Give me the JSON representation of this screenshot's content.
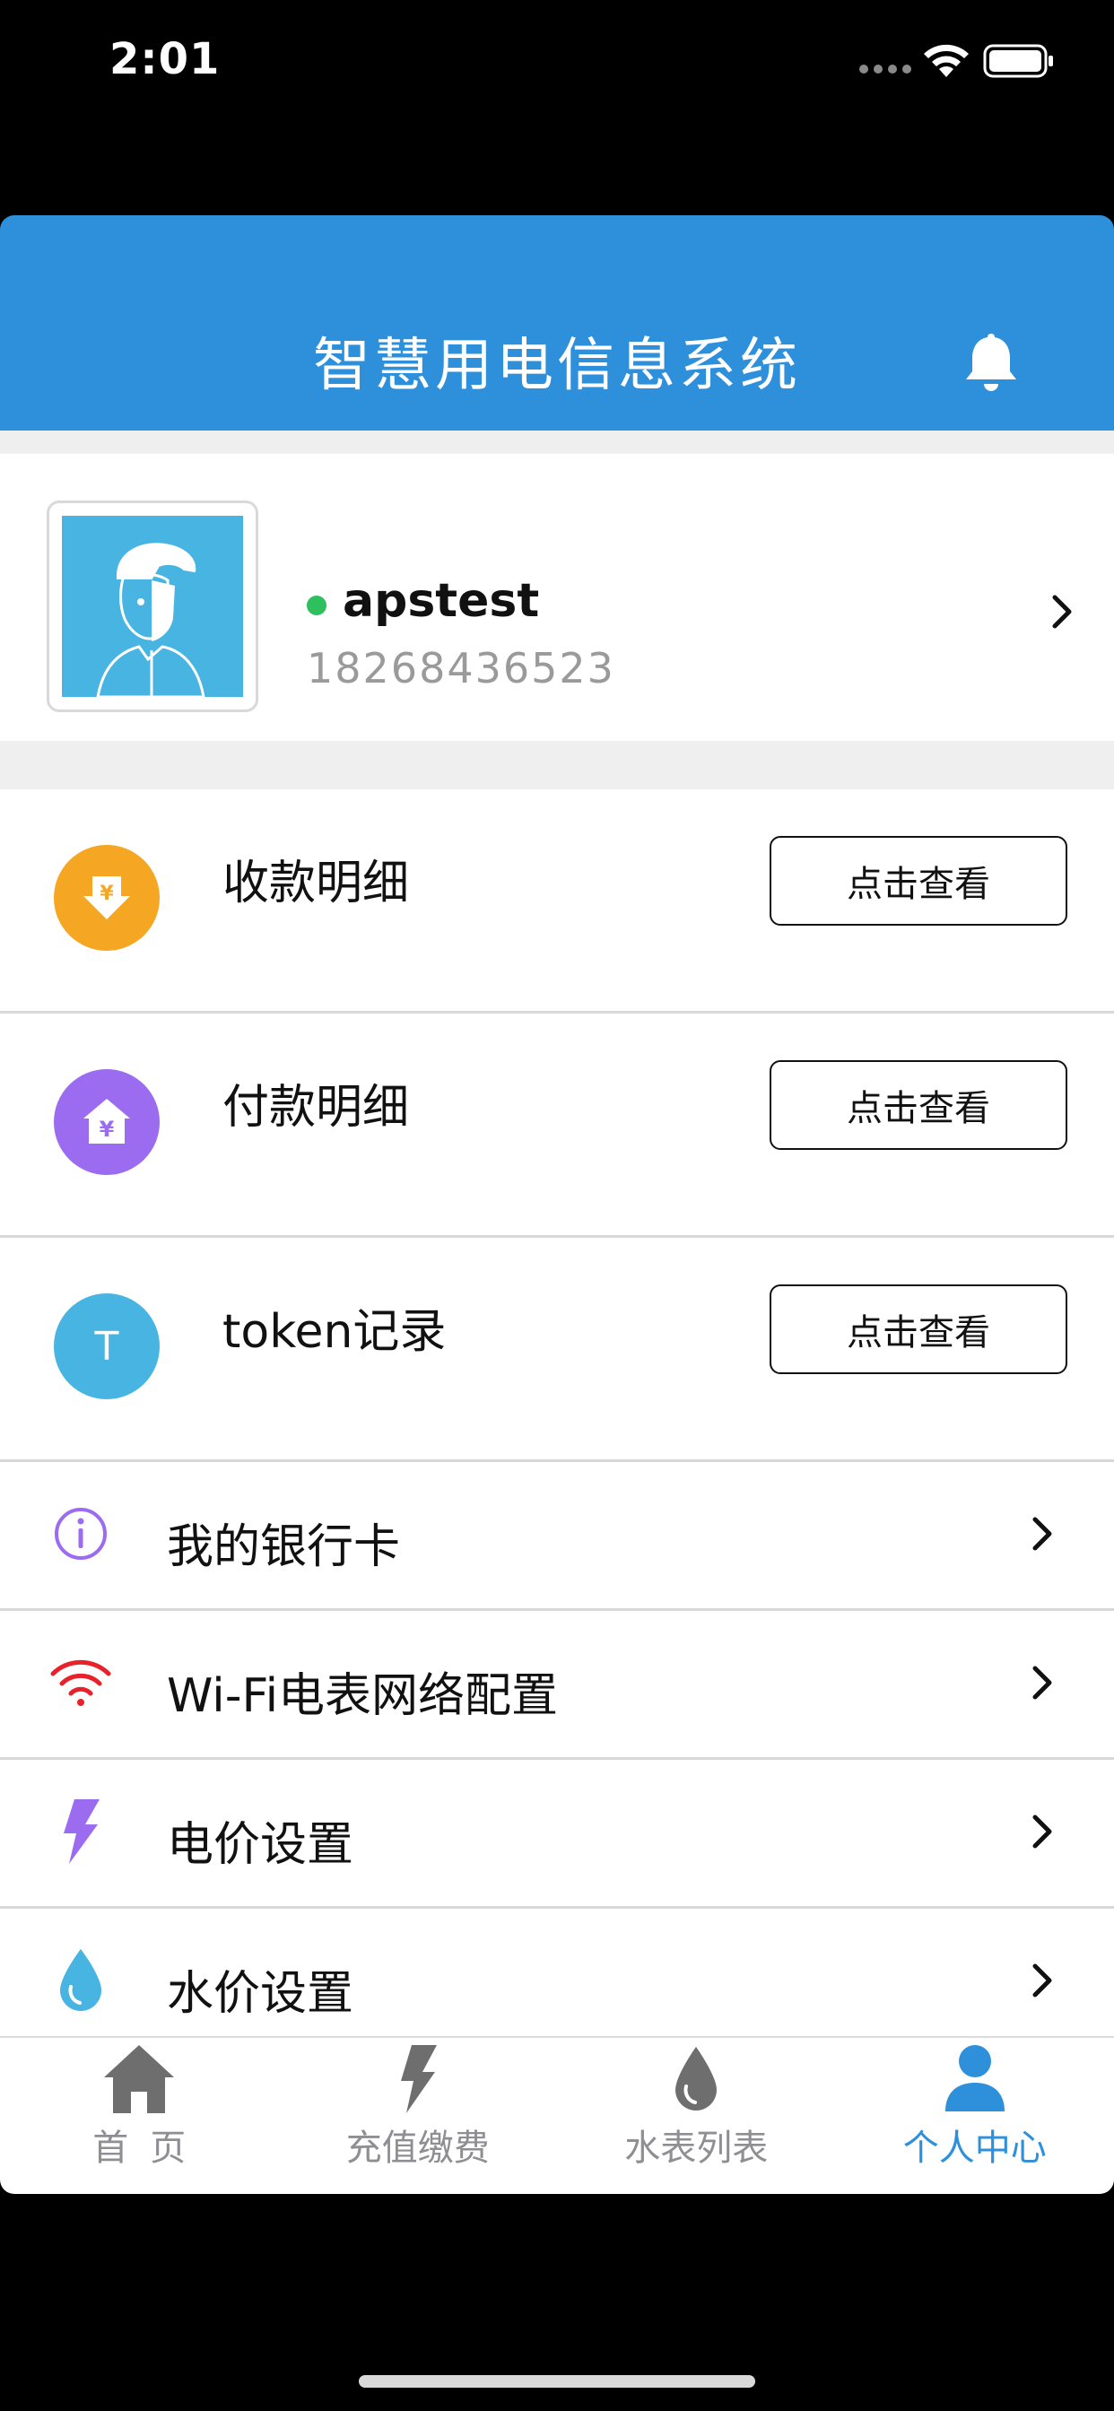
{
  "status_bar": {
    "time": "2:01"
  },
  "header": {
    "title": "智慧用电信息系统"
  },
  "profile": {
    "username": "apstest",
    "phone": "18268436523"
  },
  "records": [
    {
      "label": "收款明细",
      "button": "点击查看",
      "color": "#f5a623",
      "icon": "yen-download-icon"
    },
    {
      "label": " 付款明细",
      "button": "点击查看",
      "color": "#9b6cf0",
      "icon": "yen-house-icon"
    },
    {
      "label": "token记录",
      "button": "点击查看",
      "color": "#48b4e1",
      "icon": "t-letter-icon",
      "icon_text": "T"
    }
  ],
  "menu": [
    {
      "label": "我的银行卡",
      "icon": "info-icon",
      "color": "#9b6cf0"
    },
    {
      "label": "Wi-Fi电表网络配置",
      "icon": "wifi-icon",
      "color": "#e8212a"
    },
    {
      "label": "电价设置",
      "icon": "lightning-icon",
      "color": "#9b6cf0"
    },
    {
      "label": "水价设置",
      "icon": "water-drop-icon",
      "color": "#48b4e1"
    }
  ],
  "tabs": [
    {
      "label": "首页",
      "icon": "home-icon",
      "active": false
    },
    {
      "label": "充值缴费",
      "icon": "lightning-icon",
      "active": false
    },
    {
      "label": "水表列表",
      "icon": "water-drop-icon",
      "active": false
    },
    {
      "label": "个人中心",
      "icon": "person-icon",
      "active": true
    }
  ],
  "colors": {
    "primary": "#2e8fdb",
    "online": "#2fbf5f",
    "inactive_tab": "#8e8e93"
  }
}
